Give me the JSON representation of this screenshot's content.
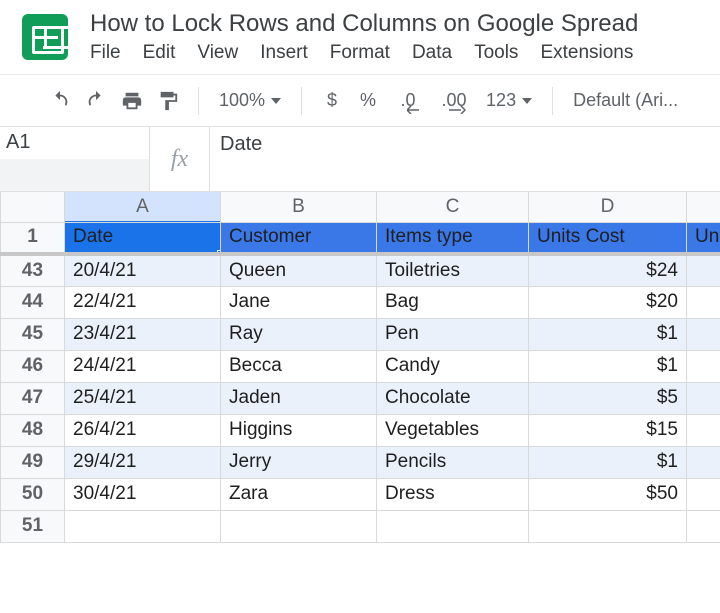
{
  "doc": {
    "title": "How to Lock Rows and Columns on Google Spread"
  },
  "menu": {
    "file": "File",
    "edit": "Edit",
    "view": "View",
    "insert": "Insert",
    "format": "Format",
    "data": "Data",
    "tools": "Tools",
    "extensions": "Extensions"
  },
  "toolbar": {
    "zoom": "100%",
    "currency": "$",
    "percent": "%",
    "dec_dec": ".0",
    "inc_dec": ".00",
    "numfmt": "123",
    "font": "Default (Ari..."
  },
  "formula_bar": {
    "name_box": "A1",
    "fx": "fx",
    "value": "Date"
  },
  "columns": {
    "A": "A",
    "B": "B",
    "C": "C",
    "D": "D",
    "E": ""
  },
  "header_row": {
    "num": "1",
    "A": "Date",
    "B": "Customer",
    "C": "Items type",
    "D": "Units Cost",
    "E": "Unit"
  },
  "rows": [
    {
      "num": "43",
      "A": "20/4/21",
      "B": "Queen",
      "C": "Toiletries",
      "D": "$24",
      "band": true
    },
    {
      "num": "44",
      "A": "22/4/21",
      "B": "Jane",
      "C": "Bag",
      "D": "$20",
      "band": false
    },
    {
      "num": "45",
      "A": "23/4/21",
      "B": "Ray",
      "C": "Pen",
      "D": "$1",
      "band": true
    },
    {
      "num": "46",
      "A": "24/4/21",
      "B": "Becca",
      "C": "Candy",
      "D": "$1",
      "band": false
    },
    {
      "num": "47",
      "A": "25/4/21",
      "B": "Jaden",
      "C": "Chocolate",
      "D": "$5",
      "band": true
    },
    {
      "num": "48",
      "A": "26/4/21",
      "B": "Higgins",
      "C": "Vegetables",
      "D": "$15",
      "band": false
    },
    {
      "num": "49",
      "A": "29/4/21",
      "B": "Jerry",
      "C": "Pencils",
      "D": "$1",
      "band": true
    },
    {
      "num": "50",
      "A": "30/4/21",
      "B": "Zara",
      "C": "Dress",
      "D": "$50",
      "band": false
    },
    {
      "num": "51",
      "A": "",
      "B": "",
      "C": "",
      "D": "",
      "band": false
    }
  ]
}
